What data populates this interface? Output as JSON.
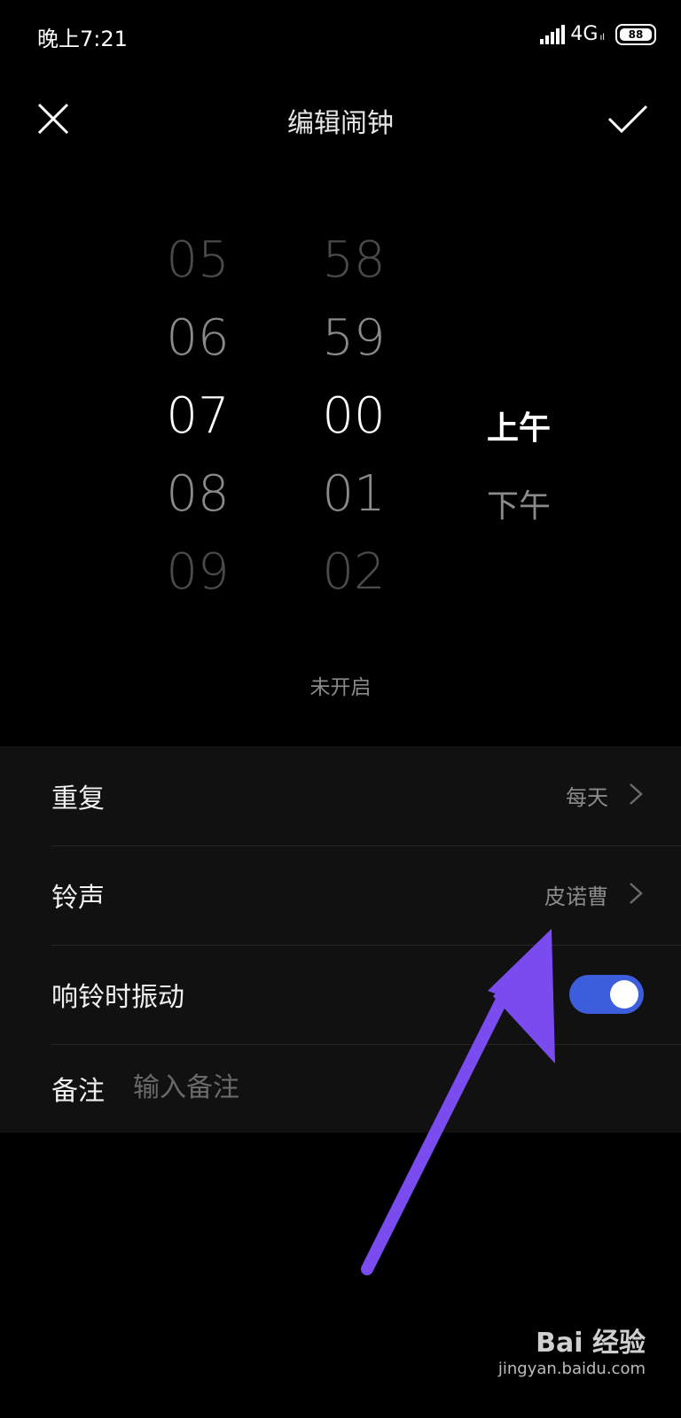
{
  "status_bar": {
    "time": "晚上7:21",
    "network": "4G",
    "network_sub": "ıl",
    "battery": "88"
  },
  "title_bar": {
    "title": "编辑闹钟"
  },
  "picker": {
    "hours": [
      "05",
      "06",
      "07",
      "08",
      "09"
    ],
    "minutes": [
      "58",
      "59",
      "00",
      "01",
      "02"
    ],
    "ampm": [
      "上午",
      "下午"
    ]
  },
  "alarm_state": "未开启",
  "settings": {
    "repeat": {
      "label": "重复",
      "value": "每天"
    },
    "ringtone": {
      "label": "铃声",
      "value": "皮诺曹"
    },
    "vibrate": {
      "label": "响铃时振动",
      "enabled": true
    },
    "note": {
      "label": "备注",
      "placeholder": "输入备注"
    }
  },
  "colors": {
    "toggle_on": "#3c5ddc",
    "arrow": "#7a4cf0"
  },
  "watermark": {
    "logo": "Bai 经验",
    "url": "jingyan.baidu.com"
  }
}
